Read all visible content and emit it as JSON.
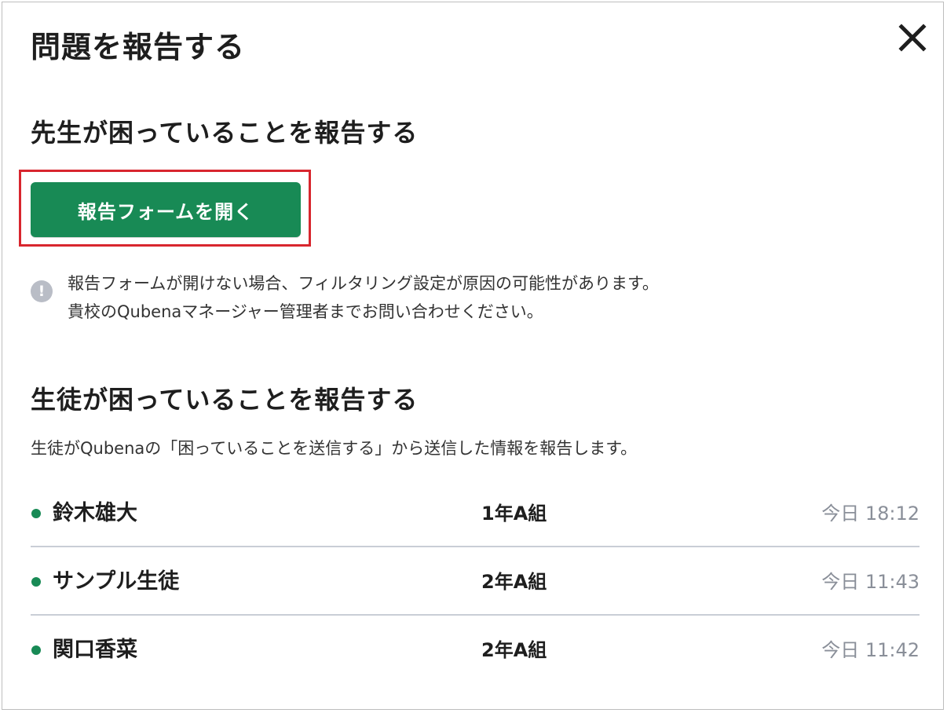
{
  "dialog": {
    "title": "問題を報告する",
    "close_icon": "close-icon"
  },
  "teacher_section": {
    "heading": "先生が困っていることを報告する",
    "open_form_button": "報告フォームを開く",
    "notice_icon": "exclamation-icon",
    "notice_lines": [
      "報告フォームが開けない場合、フィルタリング設定が原因の可能性があります。",
      "貴校のQubenaマネージャー管理者までお問い合わせください。"
    ]
  },
  "student_section": {
    "heading": "生徒が困っていることを報告する",
    "description": "生徒がQubenaの「困っていることを送信する」から送信した情報を報告します。",
    "reports": [
      {
        "name": "鈴木雄大",
        "class": "1年A組",
        "time": "今日 18:12"
      },
      {
        "name": "サンプル生徒",
        "class": "2年A組",
        "time": "今日 11:43"
      },
      {
        "name": "関口香菜",
        "class": "2年A組",
        "time": "今日 11:42"
      }
    ]
  },
  "colors": {
    "accent_green": "#188a55",
    "highlight_red": "#d8262e",
    "muted_gray": "#8a8f99"
  },
  "notice_symbol": "!"
}
